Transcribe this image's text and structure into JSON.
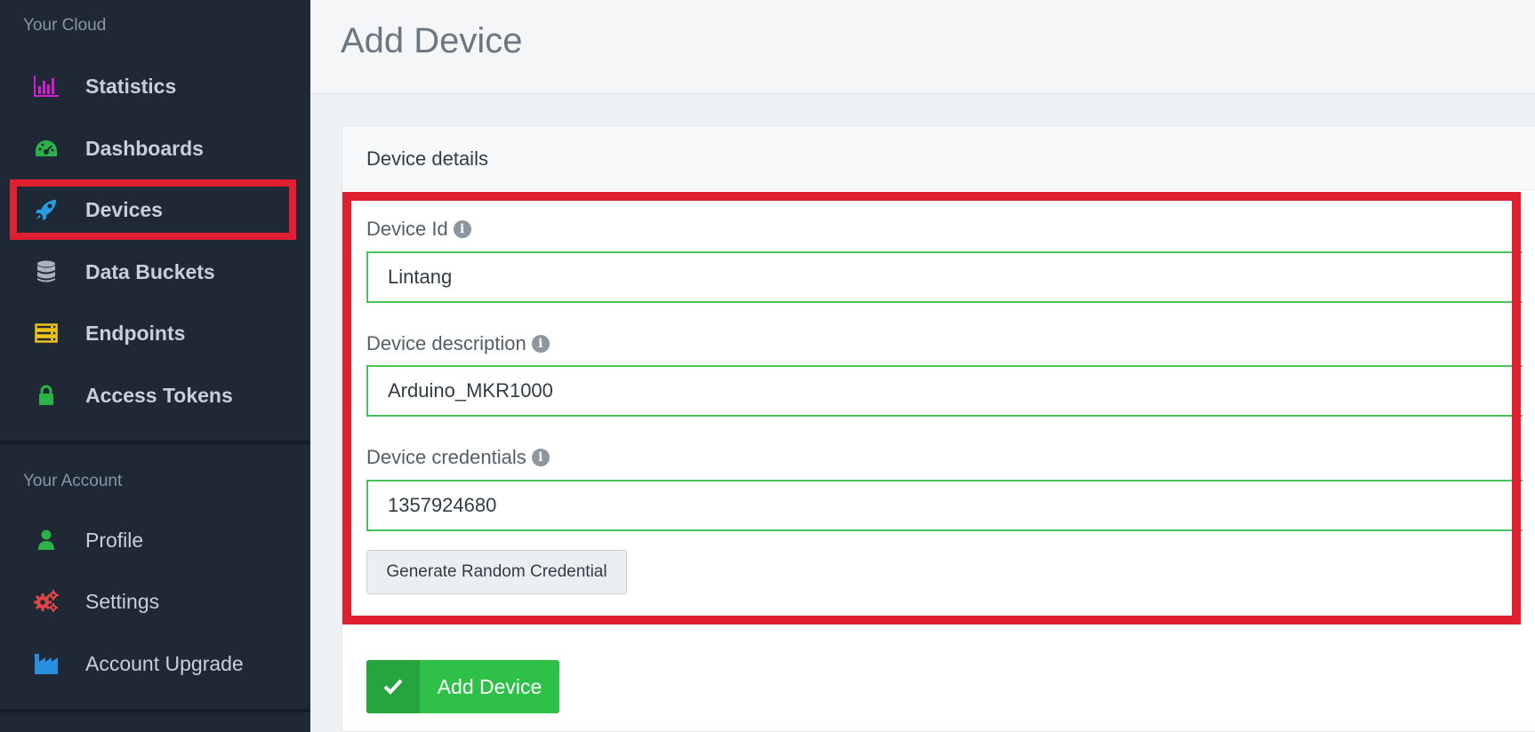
{
  "sidebar": {
    "cloud_heading": "Your Cloud",
    "account_heading": "Your Account",
    "cloud_items": [
      {
        "label": "Statistics",
        "icon": "bar-chart-icon",
        "color": "#d21fd2"
      },
      {
        "label": "Dashboards",
        "icon": "dashboard-gauge-icon",
        "color": "#2bb34a"
      },
      {
        "label": "Devices",
        "icon": "rocket-icon",
        "color": "#2b9be0",
        "active": true
      },
      {
        "label": "Data Buckets",
        "icon": "database-icon",
        "color": "#aab4be"
      },
      {
        "label": "Endpoints",
        "icon": "server-icon",
        "color": "#f0c419"
      },
      {
        "label": "Access Tokens",
        "icon": "lock-icon",
        "color": "#2bb34a"
      }
    ],
    "account_items": [
      {
        "label": "Profile",
        "icon": "user-icon",
        "color": "#2bb34a"
      },
      {
        "label": "Settings",
        "icon": "gears-icon",
        "color": "#e04848"
      },
      {
        "label": "Account Upgrade",
        "icon": "industry-icon",
        "color": "#2b8fe0"
      }
    ]
  },
  "main": {
    "page_title": "Add Device",
    "card_title": "Device details",
    "fields": [
      {
        "label": "Device Id",
        "value": "Lintang"
      },
      {
        "label": "Device description",
        "value": "Arduino_MKR1000"
      },
      {
        "label": "Device credentials",
        "value": "1357924680"
      }
    ],
    "generate_button": "Generate Random Credential",
    "add_button": "Add Device"
  },
  "colors": {
    "sidebar_bg": "#1f2935",
    "highlight": "#e02030",
    "input_border": "#46c35a",
    "primary_button": "#2fc04a"
  }
}
